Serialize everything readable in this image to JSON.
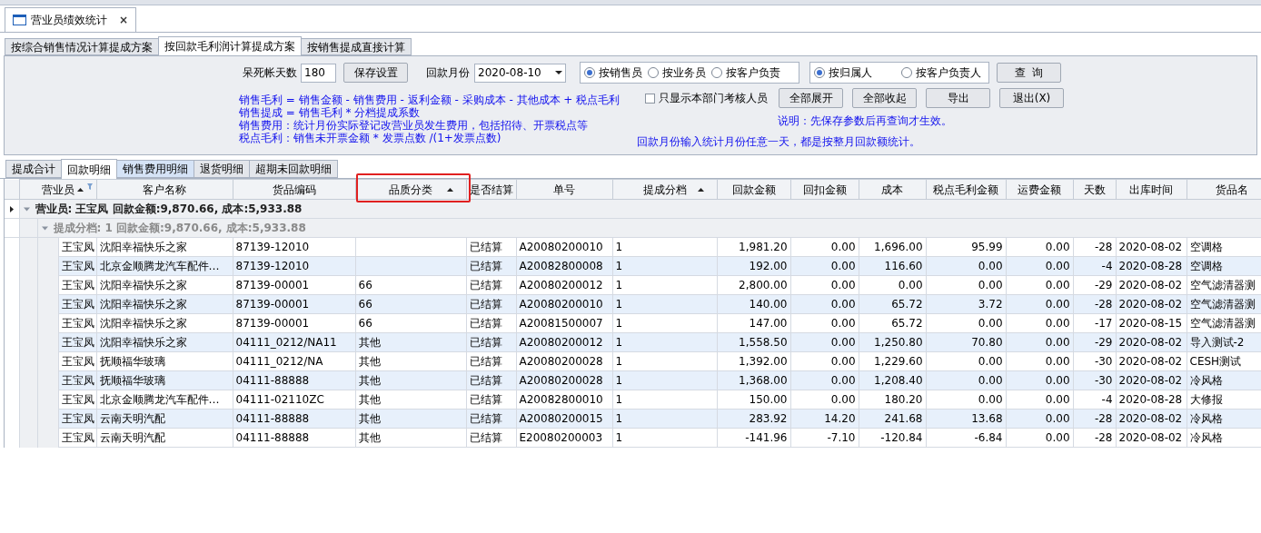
{
  "doc_tab": {
    "title": "营业员绩效统计",
    "close": "×"
  },
  "scheme_tabs": [
    {
      "label": "按综合销售情况计算提成方案",
      "selected": false
    },
    {
      "label": "按回款毛利润计算提成方案",
      "selected": true
    },
    {
      "label": "按销售提成直接计算",
      "selected": false
    }
  ],
  "settings": {
    "dead_days_label": "呆死帐天数",
    "dead_days": "180",
    "save_button": "保存设置",
    "month_label": "回款月份",
    "month": "2020-08-10"
  },
  "role_radios": [
    {
      "label": "按销售员",
      "selected": true
    },
    {
      "label": "按业务员",
      "selected": false
    },
    {
      "label": "按客户负责",
      "selected": false
    }
  ],
  "owner_radios": [
    {
      "label": "按归属人",
      "selected": true
    },
    {
      "label": "按客户负责人",
      "selected": false
    }
  ],
  "query_button": "查  询",
  "formulas": [
    "销售毛利 = 销售金额 - 销售费用 - 返利金额 - 采购成本 - 其他成本 + 税点毛利",
    "销售提成 = 销售毛利 * 分档提成系数",
    "销售费用：统计月份实际登记改营业员发生费用，包括招待、开票税点等",
    "税点毛利：销售未开票金额 * 发票点数 /(1+发票点数)"
  ],
  "dept_only": {
    "label": "只显示本部门考核人员",
    "checked": false
  },
  "buttons": [
    "全部展开",
    "全部收起",
    "导出",
    "退出(X)"
  ],
  "notes": [
    "说明：先保存参数后再查询才生效。",
    "回款月份输入统计月份任意一天，都是按整月回款额统计。"
  ],
  "detail_tabs": [
    {
      "label": "提成合计",
      "selected": false
    },
    {
      "label": "回款明细",
      "selected": true
    },
    {
      "label": "销售费用明细",
      "selected": false
    },
    {
      "label": "退货明细",
      "selected": false
    },
    {
      "label": "超期未回款明细",
      "selected": false
    }
  ],
  "table": {
    "columns": [
      {
        "label": "营业员",
        "sorted_ascending": true,
        "filter": true
      },
      {
        "label": "客户名称",
        "sorted_ascending": false,
        "filter": false
      },
      {
        "label": "货品编码",
        "sorted_ascending": false,
        "filter": false
      },
      {
        "label": "品质分类",
        "sorted_ascending": true,
        "filter": false,
        "highlighted": true
      },
      {
        "label": "是否结算",
        "sorted_ascending": false,
        "filter": false
      },
      {
        "label": "单号",
        "sorted_ascending": false,
        "filter": false
      },
      {
        "label": "提成分档",
        "sorted_ascending": true,
        "filter": false
      },
      {
        "label": "回款金额",
        "sorted_ascending": false,
        "filter": false
      },
      {
        "label": "回扣金额",
        "sorted_ascending": false,
        "filter": false
      },
      {
        "label": "成本",
        "sorted_ascending": false,
        "filter": false
      },
      {
        "label": "税点毛利金额",
        "sorted_ascending": false,
        "filter": false
      },
      {
        "label": "运费金额",
        "sorted_ascending": false,
        "filter": false
      },
      {
        "label": "天数",
        "sorted_ascending": false,
        "filter": false
      },
      {
        "label": "出库时间",
        "sorted_ascending": false,
        "filter": false
      },
      {
        "label": "货品名",
        "sorted_ascending": false,
        "filter": false
      }
    ],
    "group": {
      "label": "营业员: 王宝凤 回款金额:9,870.66, 成本:5,933.88",
      "expanded": true
    },
    "subgroup": {
      "label": "提成分档: 1 回款金额:9,870.66, 成本:5,933.88",
      "expanded": true
    },
    "rows": [
      [
        "王宝凤",
        "沈阳幸福快乐之家",
        "87139-12010",
        "",
        "已结算",
        "A20080200010",
        "1",
        "1,981.20",
        "0.00",
        "1,696.00",
        "95.99",
        "0.00",
        "-28",
        "2020-08-02",
        "空调格"
      ],
      [
        "王宝凤",
        "北京金顺腾龙汽车配件…",
        "87139-12010",
        "",
        "已结算",
        "A20082800008",
        "1",
        "192.00",
        "0.00",
        "116.60",
        "0.00",
        "0.00",
        "-4",
        "2020-08-28",
        "空调格"
      ],
      [
        "王宝凤",
        "沈阳幸福快乐之家",
        "87139-00001",
        "66",
        "已结算",
        "A20080200012",
        "1",
        "2,800.00",
        "0.00",
        "0.00",
        "0.00",
        "0.00",
        "-29",
        "2020-08-02",
        "空气滤清器测"
      ],
      [
        "王宝凤",
        "沈阳幸福快乐之家",
        "87139-00001",
        "66",
        "已结算",
        "A20080200010",
        "1",
        "140.00",
        "0.00",
        "65.72",
        "3.72",
        "0.00",
        "-28",
        "2020-08-02",
        "空气滤清器测"
      ],
      [
        "王宝凤",
        "沈阳幸福快乐之家",
        "87139-00001",
        "66",
        "已结算",
        "A20081500007",
        "1",
        "147.00",
        "0.00",
        "65.72",
        "0.00",
        "0.00",
        "-17",
        "2020-08-15",
        "空气滤清器测"
      ],
      [
        "王宝凤",
        "沈阳幸福快乐之家",
        "04111_0212/NA11",
        "其他",
        "已结算",
        "A20080200012",
        "1",
        "1,558.50",
        "0.00",
        "1,250.80",
        "70.80",
        "0.00",
        "-29",
        "2020-08-02",
        "导入测试-2"
      ],
      [
        "王宝凤",
        "抚顺福华玻璃",
        "04111_0212/NA",
        "其他",
        "已结算",
        "A20080200028",
        "1",
        "1,392.00",
        "0.00",
        "1,229.60",
        "0.00",
        "0.00",
        "-30",
        "2020-08-02",
        "CESH测试"
      ],
      [
        "王宝凤",
        "抚顺福华玻璃",
        "04111-88888",
        "其他",
        "已结算",
        "A20080200028",
        "1",
        "1,368.00",
        "0.00",
        "1,208.40",
        "0.00",
        "0.00",
        "-30",
        "2020-08-02",
        "冷风格"
      ],
      [
        "王宝凤",
        "北京金顺腾龙汽车配件…",
        "04111-02110ZC",
        "其他",
        "已结算",
        "A20082800010",
        "1",
        "150.00",
        "0.00",
        "180.20",
        "0.00",
        "0.00",
        "-4",
        "2020-08-28",
        "大修报"
      ],
      [
        "王宝凤",
        "云南天明汽配",
        "04111-88888",
        "其他",
        "已结算",
        "A20080200015",
        "1",
        "283.92",
        "14.20",
        "241.68",
        "13.68",
        "0.00",
        "-28",
        "2020-08-02",
        "冷风格"
      ],
      [
        "王宝凤",
        "云南天明汽配",
        "04111-88888",
        "其他",
        "已结算",
        "E20080200003",
        "1",
        "-141.96",
        "-7.10",
        "-120.84",
        "-6.84",
        "0.00",
        "-28",
        "2020-08-02",
        "冷风格"
      ]
    ]
  }
}
